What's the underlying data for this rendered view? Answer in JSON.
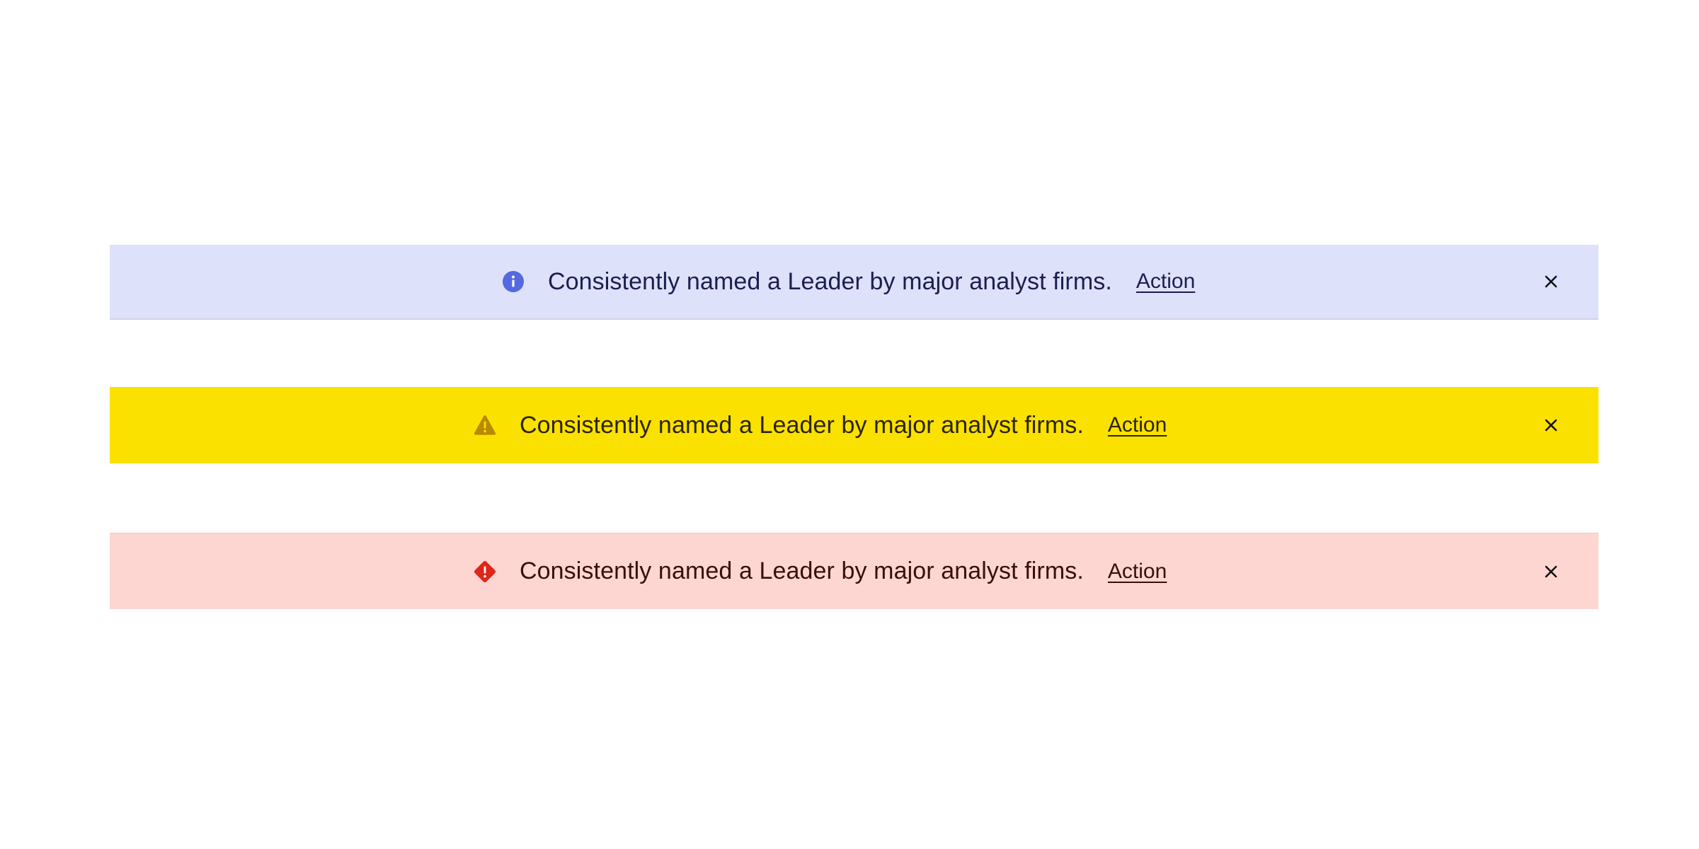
{
  "banners": [
    {
      "kind": "info",
      "icon": "info-circle-icon",
      "message": "Consistently named a Leader by major analyst firms.",
      "action_label": "Action",
      "close_icon": "close-icon",
      "colors": {
        "background": "#dde1f9",
        "icon": "#5468e0",
        "text": "#1b1f4f"
      }
    },
    {
      "kind": "warning",
      "icon": "warning-triangle-icon",
      "message": "Consistently named a Leader by major analyst firms.",
      "action_label": "Action",
      "close_icon": "close-icon",
      "colors": {
        "background": "#fbe100",
        "icon": "#b88a00",
        "text": "#2b2400"
      }
    },
    {
      "kind": "error",
      "icon": "error-diamond-icon",
      "message": "Consistently named a Leader by major analyst firms.",
      "action_label": "Action",
      "close_icon": "close-icon",
      "colors": {
        "background": "#fdd6d1",
        "icon": "#e0261a",
        "text": "#3a0f0b"
      }
    }
  ]
}
